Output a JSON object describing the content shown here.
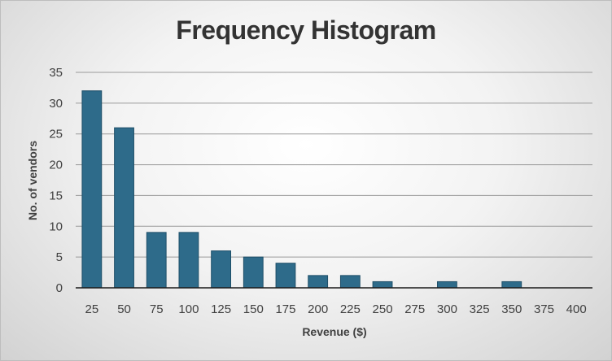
{
  "chart_data": {
    "type": "bar",
    "title": "Frequency Histogram",
    "xlabel": "Revenue ($)",
    "ylabel": "No. of vendors",
    "categories": [
      "25",
      "50",
      "75",
      "100",
      "125",
      "150",
      "175",
      "200",
      "225",
      "250",
      "275",
      "300",
      "325",
      "350",
      "375",
      "400"
    ],
    "values": [
      32,
      26,
      9,
      9,
      6,
      5,
      4,
      2,
      2,
      1,
      0,
      1,
      0,
      1,
      0,
      0
    ],
    "ylim": [
      0,
      35
    ],
    "yticks": [
      0,
      5,
      10,
      15,
      20,
      25,
      30,
      35
    ],
    "grid": true,
    "legend": "none",
    "bar_color": "#2e6b8a",
    "bar_edge_color": "#1f4f68"
  }
}
